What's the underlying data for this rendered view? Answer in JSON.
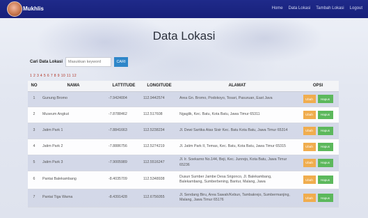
{
  "navbar": {
    "brand": "Mukhlis",
    "links": [
      "Home",
      "Data Lokasi",
      "Tambah Lokasi",
      "Logout"
    ]
  },
  "page": {
    "title": "Data Lokasi"
  },
  "search": {
    "label": "Cari Data Lokasi",
    "placeholder": "Masukkan keyword",
    "button": "CARI"
  },
  "pagination": {
    "text": "1 2 3 4 5 6 7 8 9 10 11 12"
  },
  "table": {
    "headers": [
      "NO",
      "NAMA",
      "LATTITUDE",
      "LONGITUDE",
      "ALAMAT",
      "OPSI"
    ],
    "rows": [
      {
        "no": "1",
        "nama": "Gunung Bromo",
        "lat": "-7.9424004",
        "lng": "112.9442574",
        "alamat": "Area Gn. Bromo, Podokoyo, Tosari, Pasuruan, East Java"
      },
      {
        "no": "2",
        "nama": "Museum Angkut",
        "lat": "-7.8788462",
        "lng": "112.517608",
        "alamat": "Ngaglik, Kec. Batu, Kota Batu, Jawa Timur 65311"
      },
      {
        "no": "3",
        "nama": "Jatim Park 1",
        "lat": "-7.8841663",
        "lng": "112.5238234",
        "alamat": "Jl. Dewi Sartika Atas Sisir Kec. Batu Kota Batu, Jawa Timur 65314"
      },
      {
        "no": "4",
        "nama": "Jatim Park 2",
        "lat": "-7.8886756",
        "lng": "112.5274219",
        "alamat": "Jl. Jatim Park II, Temas, Kec. Batu, Kota Batu, Jawa Timur 65315"
      },
      {
        "no": "5",
        "nama": "Jatim Park 3",
        "lat": "-7.9005989",
        "lng": "112.5516247",
        "alamat": "Jl. Ir. Soekarno No.144, Beji, Kec. Junrejo, Kota Batu, Jawa Timur 65236"
      },
      {
        "no": "6",
        "nama": "Pantai Balekambang",
        "lat": "-8.4035709",
        "lng": "112.5348938",
        "alamat": "Dusun Sumber Jambe Desa Srigonco, Jl. Balekambang, Balekambang, Sumberbening, Bantur, Malang, Jawa"
      },
      {
        "no": "7",
        "nama": "Pantai Tiga Warna",
        "lat": "-8.4391428",
        "lng": "112.6756055",
        "alamat": "Jl. Sendang Biru, Area Sawah/Kebun, Tambakrejo, Sumbermanjing, Malang, Jawa Timur 65176"
      }
    ],
    "edit_label": "Ubah",
    "delete_label": "Hapus"
  },
  "colors": {
    "navbar": "#1f2a8a",
    "search_button": "#2e86c9",
    "edit_button": "#f0ad4e",
    "delete_button": "#5cb85c"
  }
}
